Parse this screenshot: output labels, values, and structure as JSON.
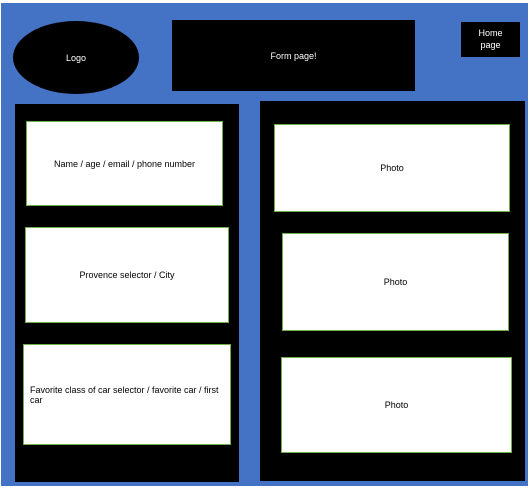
{
  "header": {
    "logo": "Logo",
    "title": "Form page!",
    "home": "Home\npage"
  },
  "form_fields": [
    "Name / age / email / phone number",
    "Provence selector / City",
    "Favorite class of car selector / favorite car / first car"
  ],
  "photos": [
    "Photo",
    "Photo",
    "Photo"
  ]
}
